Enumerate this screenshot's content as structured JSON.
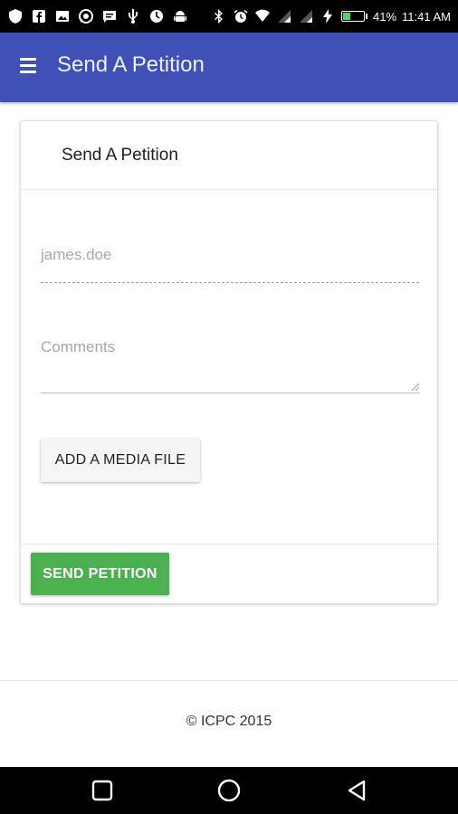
{
  "status_bar": {
    "battery": "41%",
    "time": "11:41 AM",
    "battery_level": 0.41,
    "left_icons": [
      "shield-icon",
      "facebook-icon",
      "image-icon",
      "whatsapp-icon",
      "message-icon",
      "usb-icon",
      "clock-icon",
      "android-icon"
    ],
    "right_icons": [
      "bluetooth-icon",
      "alarm-icon",
      "wifi-icon",
      "signal-icon",
      "signal-icon",
      "charging-icon"
    ]
  },
  "app_bar": {
    "title": "Send A Petition",
    "background": "#3f51b5"
  },
  "card": {
    "title": "Send A Petition",
    "username_field": {
      "placeholder": "james.doe",
      "value": ""
    },
    "comments_field": {
      "placeholder": "Comments",
      "value": ""
    },
    "add_media_label": "ADD A MEDIA FILE",
    "send_label": "SEND PETITION",
    "send_color": "#4caf50"
  },
  "footer": {
    "copyright": "© ICPC 2015"
  },
  "nav_bar": {
    "buttons": [
      "recents-icon",
      "home-icon",
      "back-icon"
    ]
  }
}
